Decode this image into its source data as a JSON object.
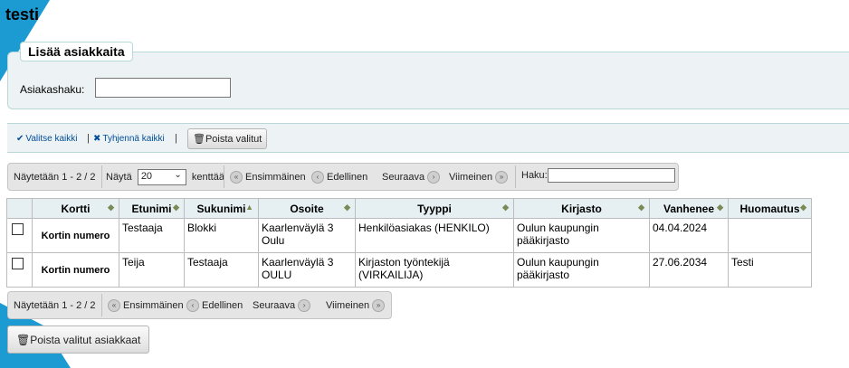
{
  "page": {
    "title": "testi"
  },
  "add_patrons": {
    "legend": "Lisää asiakkaita",
    "search_label": "Asiakashaku:",
    "search_value": ""
  },
  "selection": {
    "select_all": "Valitse kaikki",
    "clear_all": "Tyhjennä kaikki",
    "separator": "|",
    "remove_selected": "Poista valitut"
  },
  "pager_top": {
    "info": "Näytetään 1 - 2 / 2",
    "show_label": "Näytä",
    "page_length": "20",
    "fields_label": "kenttää",
    "first": "Ensimmäinen",
    "previous": "Edellinen",
    "next": "Seuraava",
    "last": "Viimeinen",
    "search_label": "Haku:",
    "search_value": ""
  },
  "table": {
    "columns": [
      "Kortti",
      "Etunimi",
      "Sukunimi",
      "Osoite",
      "Tyyppi",
      "Kirjasto",
      "Vanhenee",
      "Huomautus"
    ],
    "rows": [
      {
        "card": "Kortin numero",
        "firstname": "Testaaja",
        "surname": "Blokki",
        "address": "Kaarlenväylä 3 Oulu",
        "type": "Henkilöasiakas (HENKILO)",
        "library": "Oulun kaupungin pääkirjasto",
        "expires": "04.04.2024",
        "note": ""
      },
      {
        "card": "Kortin numero",
        "firstname": "Teija",
        "surname": "Testaaja",
        "address": "Kaarlenväylä 3 OULU",
        "type": "Kirjaston työntekijä (VIRKAILIJA)",
        "library": "Oulun kaupungin pääkirjasto",
        "expires": "27.06.2034",
        "note": "Testi"
      }
    ]
  },
  "pager_bottom": {
    "info": "Näytetään 1 - 2 / 2",
    "first": "Ensimmäinen",
    "previous": "Edellinen",
    "next": "Seuraava",
    "last": "Viimeinen"
  },
  "footer": {
    "remove_selected_patrons": "Poista valitut asiakkaat"
  },
  "icons": {
    "check": "check-icon",
    "clear": "x-icon",
    "trash": "trash-icon",
    "first": "double-left-icon",
    "previous": "left-icon",
    "next": "right-icon",
    "last": "double-right-icon",
    "sort": "sort-icon"
  },
  "colors": {
    "link": "#004d99",
    "panel_bg": "#edf3f4",
    "accent_corner": "#1b9bd1",
    "header_bg": "#e6f0f2"
  }
}
